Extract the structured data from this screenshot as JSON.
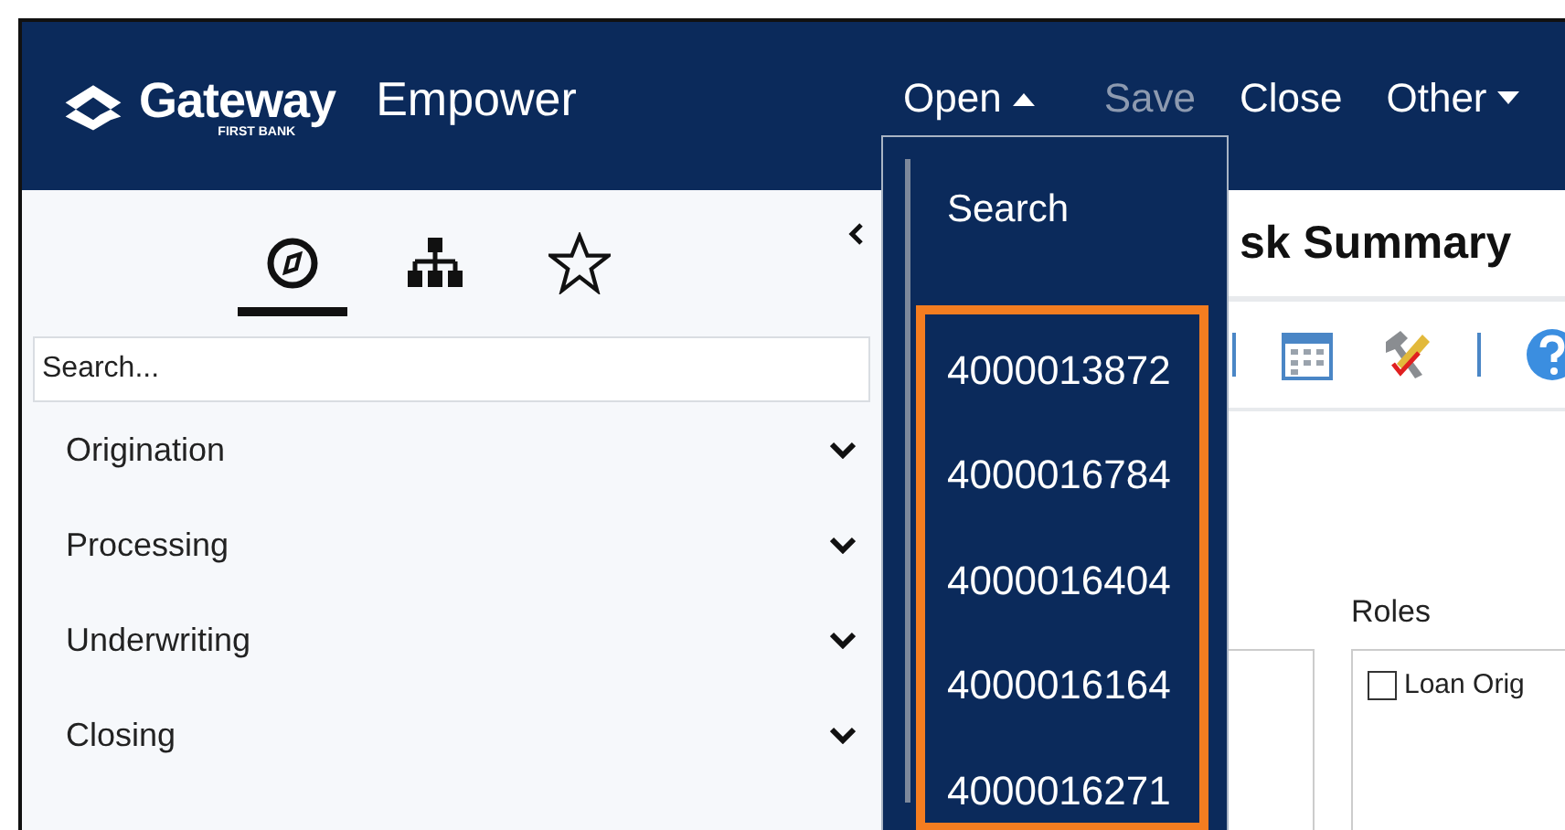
{
  "header": {
    "logo": {
      "name": "Gateway",
      "tagline": "FIRST BANK"
    },
    "app_name": "Empower",
    "menu": [
      {
        "label": "Open",
        "kind": "dropdown",
        "expanded": true,
        "disabled": false
      },
      {
        "label": "Save",
        "kind": "plain",
        "disabled": true
      },
      {
        "label": "Close",
        "kind": "plain",
        "disabled": false
      },
      {
        "label": "Other",
        "kind": "dropdown",
        "expanded": false,
        "disabled": false
      }
    ]
  },
  "open_menu": {
    "search": "Search",
    "recent_highlighted": true,
    "recent": [
      "4000013872",
      "4000016784",
      "4000016404",
      "4000016164",
      "4000016271"
    ]
  },
  "sidebar": {
    "tabs": [
      {
        "kind": "compass",
        "selected": true
      },
      {
        "kind": "hierarchy",
        "selected": false
      },
      {
        "kind": "star",
        "selected": false
      }
    ],
    "search": {
      "placeholder": "Search..."
    },
    "items": [
      {
        "label": "Origination",
        "expanded": false
      },
      {
        "label": "Processing",
        "expanded": false
      },
      {
        "label": "Underwriting",
        "expanded": false
      },
      {
        "label": "Closing",
        "expanded": false
      }
    ]
  },
  "main": {
    "title": "sk Summary",
    "roles": {
      "label": "Roles",
      "options": [
        {
          "label": "Loan Orig",
          "checked": false
        }
      ]
    }
  }
}
